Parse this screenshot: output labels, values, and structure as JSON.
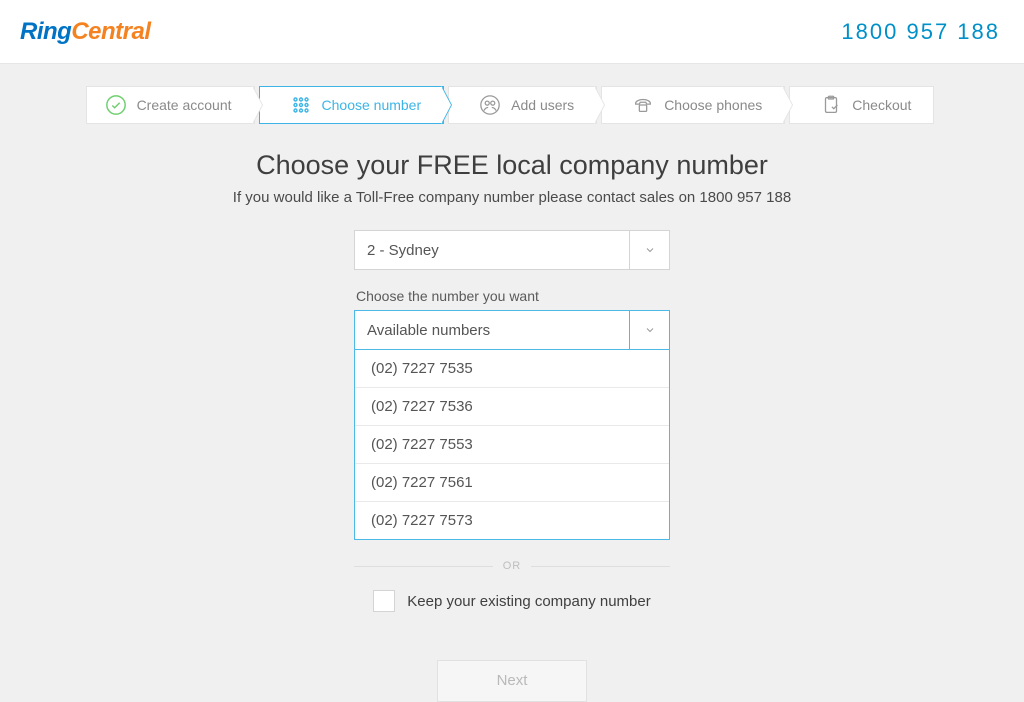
{
  "header": {
    "logo_part1": "Ring",
    "logo_part2": "Central",
    "phone": "1800 957 188"
  },
  "steps": [
    {
      "label": "Create account"
    },
    {
      "label": "Choose number"
    },
    {
      "label": "Add users"
    },
    {
      "label": "Choose phones"
    },
    {
      "label": "Checkout"
    }
  ],
  "page": {
    "title": "Choose your FREE local company number",
    "subtitle": "If you would like a Toll-Free company number please contact sales on 1800 957 188",
    "area_select_value": "2 - Sydney",
    "number_label": "Choose the number you want",
    "number_select_placeholder": "Available numbers",
    "available_numbers": [
      "(02) 7227 7535",
      "(02) 7227 7536",
      "(02) 7227 7553",
      "(02) 7227 7561",
      "(02) 7227 7573"
    ],
    "or_text": "OR",
    "keep_existing_label": "Keep your existing company number",
    "next_button": "Next"
  }
}
